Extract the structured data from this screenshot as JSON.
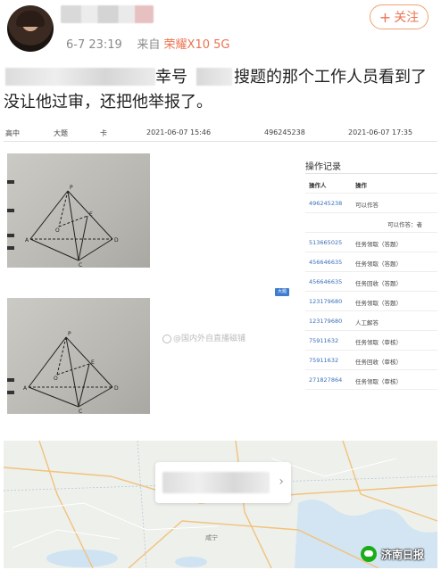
{
  "post": {
    "meta_time": "6-7 23:19",
    "meta_from": "来自",
    "meta_device": "荣耀X10 5G",
    "follow_label": "关注",
    "text_a": "幸号",
    "text_b": "搜题的那个工作人员看到了",
    "text_line2": "没让他过审，还把他举报了。"
  },
  "screenshot": {
    "header": {
      "grade": "高中",
      "type": "大题",
      "subject": "卡",
      "created": "2021-06-07 15:46",
      "id": "496245238",
      "updated": "2021-06-07 17:35"
    },
    "tag": "大题",
    "watermark": "@国内外自直播磁铺",
    "log": {
      "title": "操作记录",
      "columns": [
        "操作人",
        "操作"
      ],
      "note": "可以作答：者",
      "rows": [
        {
          "user": "496245238",
          "action": "可以作答"
        },
        {
          "user": "513665025",
          "action": "任务领取（答题）"
        },
        {
          "user": "456646635",
          "action": "任务领取（答题）"
        },
        {
          "user": "456646635",
          "action": "任务回收（答题）"
        },
        {
          "user": "123179680",
          "action": "任务领取（答题）"
        },
        {
          "user": "123179680",
          "action": "人工解答"
        },
        {
          "user": "75911632",
          "action": "任务领取（审核）"
        },
        {
          "user": "75911632",
          "action": "任务回收（审核）"
        },
        {
          "user": "271827864",
          "action": "任务领取（审核）"
        }
      ]
    }
  },
  "map": {
    "label_city": "咸宁"
  },
  "brand": {
    "name": "济南日报"
  },
  "colors": {
    "accent": "#eb7350",
    "link": "#3b6fb8",
    "tag": "#3e7ccf"
  }
}
